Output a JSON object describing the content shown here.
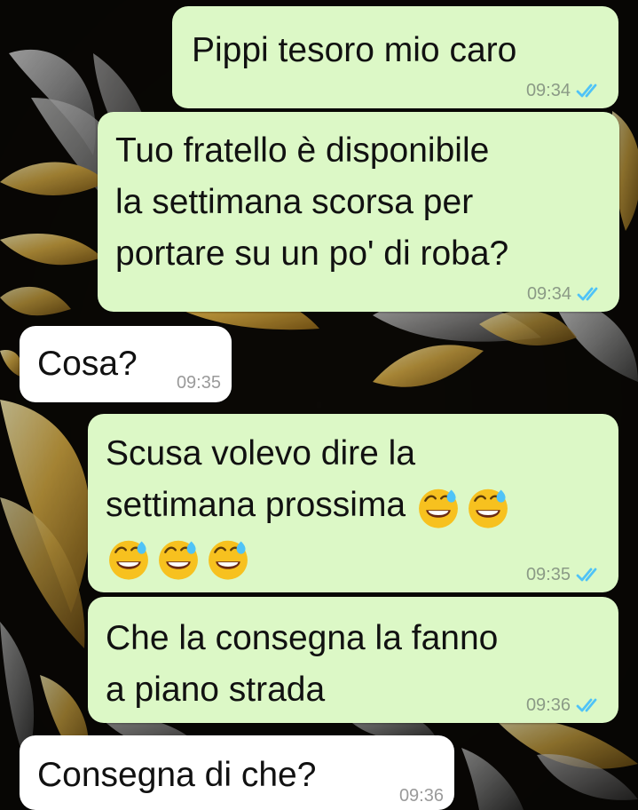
{
  "messages": [
    {
      "direction": "out",
      "lines": [
        "Pippi tesoro mio caro"
      ],
      "time": "09:34",
      "status_icon": "double-check-read-icon"
    },
    {
      "direction": "out",
      "lines": [
        "Tuo fratello è disponibile",
        "la settimana scorsa per",
        "portare su un po' di roba?"
      ],
      "time": "09:34",
      "status_icon": "double-check-read-icon"
    },
    {
      "direction": "in",
      "lines": [
        "Cosa?"
      ],
      "time": "09:35"
    },
    {
      "direction": "out",
      "lines": [
        "Scusa volevo dire la",
        "settimana prossima"
      ],
      "emoji": "grinning-face-with-sweat-icon",
      "emoji_count": 5,
      "time": "09:35",
      "status_icon": "double-check-read-icon"
    },
    {
      "direction": "out",
      "lines": [
        "Che la consegna la fanno",
        "a piano strada"
      ],
      "time": "09:36",
      "status_icon": "double-check-read-icon"
    },
    {
      "direction": "in",
      "lines": [
        "Consegna di che?"
      ],
      "time": "09:36"
    }
  ],
  "colors": {
    "outgoing_bubble": "#dcf8c6",
    "incoming_bubble": "#ffffff",
    "read_ticks": "#4fc3f7",
    "wallpaper_dark": "#0b0906",
    "wallpaper_gold": "#d8ad45",
    "wallpaper_silver": "#9c9c9c"
  }
}
